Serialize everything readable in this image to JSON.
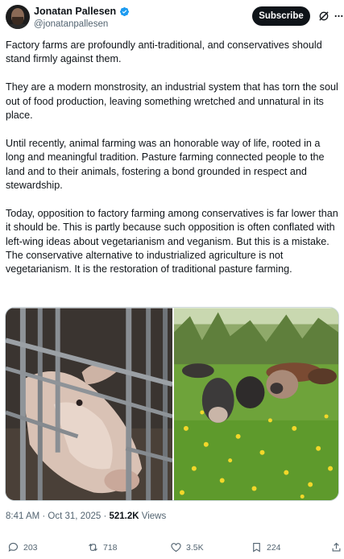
{
  "author": {
    "display_name": "Jonatan Pallesen",
    "handle": "@jonatanpallesen",
    "verified": true
  },
  "header": {
    "subscribe_label": "Subscribe"
  },
  "post": {
    "paragraphs": [
      "Factory farms are profoundly anti-traditional, and conservatives should stand firmly against them.",
      "They are a modern monstrosity, an industrial system that has torn the soul out of food production, leaving something wretched and unnatural in its place.",
      "Until recently, animal farming was an honorable way of life, rooted in a long and meaningful tradition. Pasture farming connected people to the land and to their animals, fostering a bond grounded in respect and stewardship.",
      "Today, opposition to factory farming among conservatives is far lower than it should be. This is partly because such opposition is often conflated with left-wing ideas about vegetarianism and veganism. But this is a mistake. The conservative alternative to industrialized agriculture is not vegetarianism. It is the restoration of traditional pasture farming."
    ],
    "timestamp": "8:41 AM · Oct 31, 2025 · ",
    "views_count": "521.2K",
    "views_label": " Views"
  },
  "actions": {
    "replies": "203",
    "reposts": "718",
    "likes": "3.5K",
    "bookmarks": "224"
  },
  "colors": {
    "verified_blue": "#1d9bf0",
    "secondary_text": "#536471",
    "primary_text": "#0f1419"
  },
  "icons": [
    "verified-badge-icon",
    "grok-icon",
    "more-icon",
    "reply-icon",
    "repost-icon",
    "like-icon",
    "bookmark-icon",
    "share-icon"
  ]
}
